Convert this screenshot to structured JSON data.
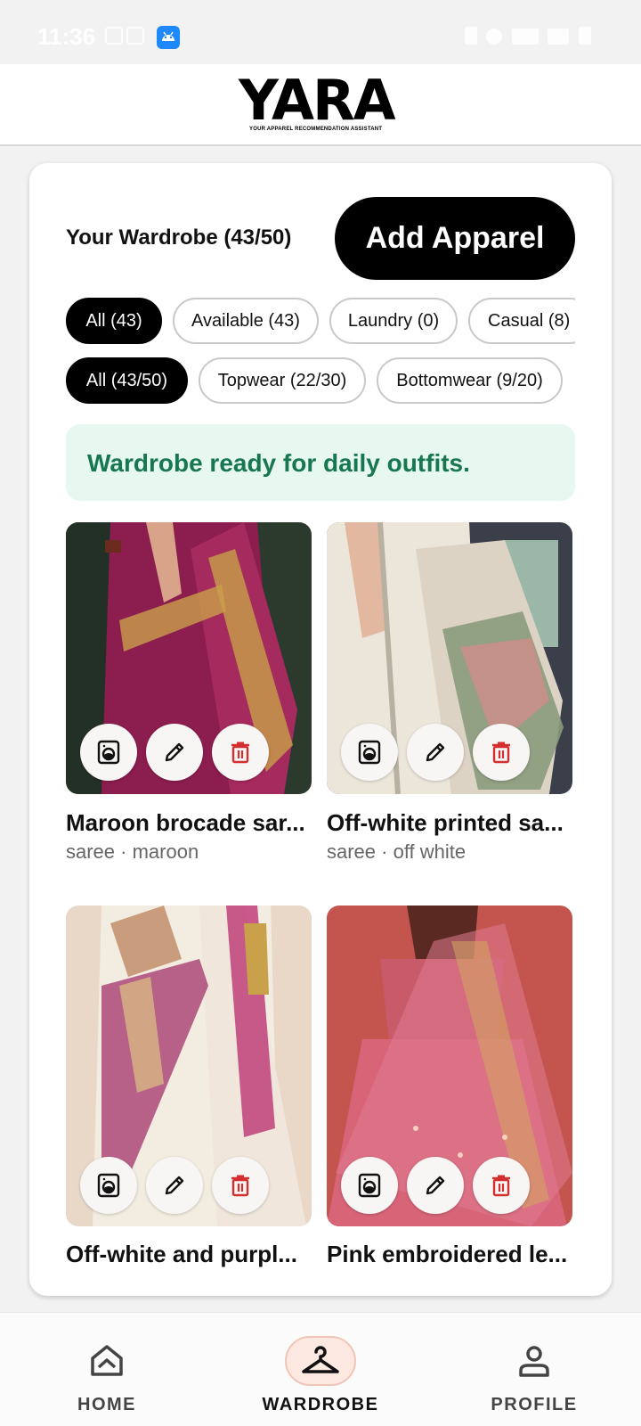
{
  "status_bar": {
    "time": "11:36",
    "android_icon": "android-icon"
  },
  "header": {
    "logo_text": "YARA",
    "logo_tagline": "YOUR APPAREL RECOMMENDATION ASSISTANT"
  },
  "wardrobe": {
    "title": "Your Wardrobe (43/50)",
    "add_button": "Add Apparel"
  },
  "status_filters": [
    {
      "label": "All (43)",
      "active": true
    },
    {
      "label": "Available (43)",
      "active": false
    },
    {
      "label": "Laundry (0)",
      "active": false
    },
    {
      "label": "Casual (8)",
      "active": false
    }
  ],
  "category_filters": [
    {
      "label": "All (43/50)",
      "active": true
    },
    {
      "label": "Topwear (22/30)",
      "active": false
    },
    {
      "label": "Bottomwear (9/20)",
      "active": false
    }
  ],
  "banner": {
    "text": "Wardrobe ready for daily outfits."
  },
  "items": [
    {
      "name": "Maroon brocade sar...",
      "meta": "saree · maroon"
    },
    {
      "name": "Off-white printed sa...",
      "meta": "saree · off white"
    },
    {
      "name": "Off-white and purpl...",
      "meta": ""
    },
    {
      "name": "Pink embroidered le...",
      "meta": ""
    }
  ],
  "item_actions": {
    "laundry": "washing-machine-icon",
    "edit": "pencil-icon",
    "delete": "trash-icon"
  },
  "nav": [
    {
      "label": "HOME",
      "icon": "home-icon",
      "active": false
    },
    {
      "label": "WARDROBE",
      "icon": "hanger-icon",
      "active": true
    },
    {
      "label": "PROFILE",
      "icon": "person-icon",
      "active": false
    }
  ],
  "colors": {
    "accent": "#000000",
    "banner_bg": "#e7f8f0",
    "banner_text": "#17774f",
    "delete": "#d32f2f",
    "nav_active_bg": "#fde8e2"
  }
}
